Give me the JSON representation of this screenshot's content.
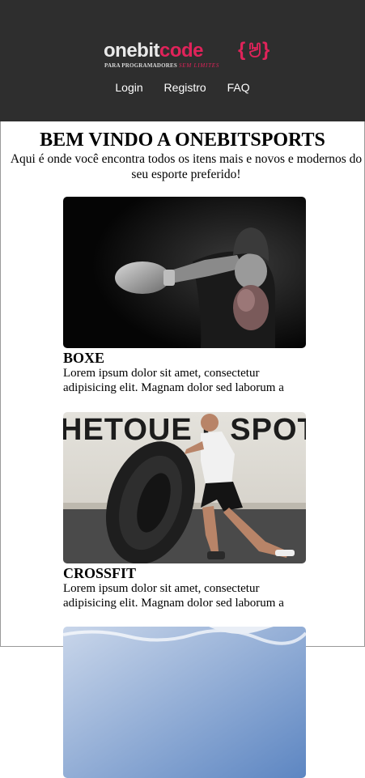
{
  "header": {
    "logo": {
      "word_one": "onebit",
      "word_code": "code",
      "brace_open": "{",
      "brace_close": "}",
      "tagline_main": "PARA PROGRAMADORES",
      "tagline_accent": "SEM LIMITES",
      "icon": "rock-hand-icon"
    },
    "nav": [
      {
        "label": "Login"
      },
      {
        "label": "Registro"
      },
      {
        "label": "FAQ"
      }
    ]
  },
  "hero": {
    "title": "BEM VINDO A ONEBITSPORTS",
    "subtitle": "Aqui é onde você encontra todos os itens mais e novos e modernos do seu esporte preferido!"
  },
  "cards": [
    {
      "title": "BOXE",
      "text": "Lorem ipsum dolor sit amet, consectetur adipisicing elit. Magnam dolor sed laborum a",
      "image": "boxer-photo"
    },
    {
      "title": "CROSSFIT",
      "text": "Lorem ipsum dolor sit amet, consectetur adipisicing elit. Magnam dolor sed laborum a",
      "image": "crossfit-tire-flip-photo",
      "wall_text": "HETOUE L SPOT"
    },
    {
      "image": "swimming-photo"
    }
  ],
  "colors": {
    "header_bg": "#2e2e2e",
    "brand_accent": "#e0235a",
    "page_bg": "#ffffff"
  }
}
